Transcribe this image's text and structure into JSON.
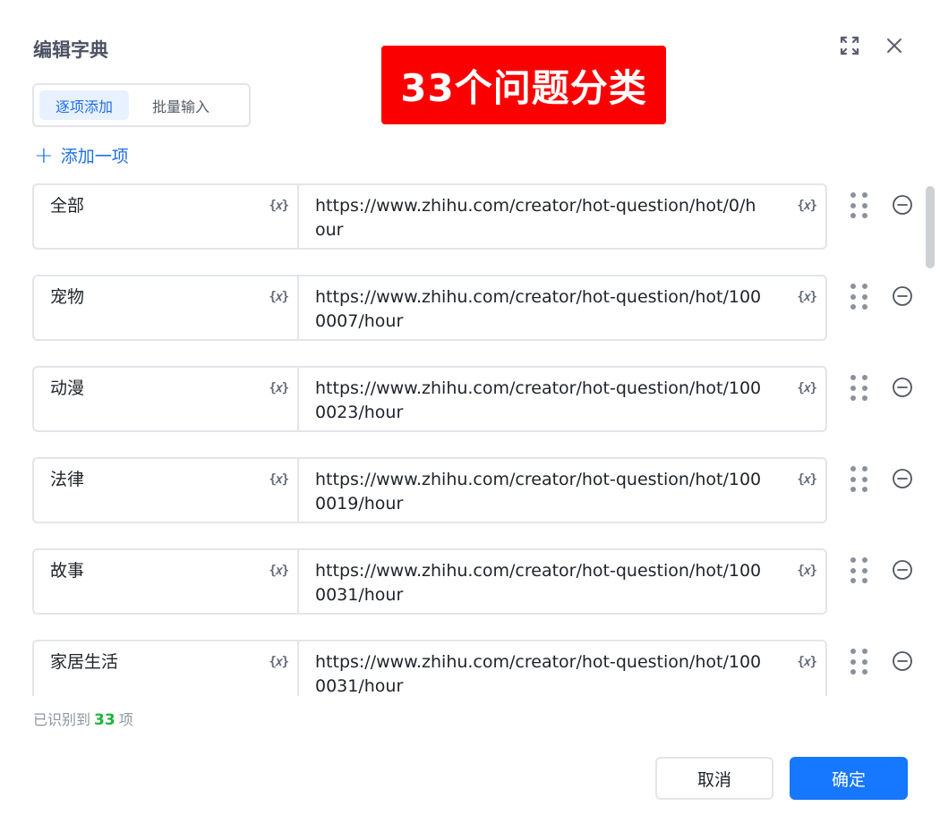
{
  "dialog": {
    "title": "编辑字典",
    "banner": "33个问题分类",
    "tabs": [
      {
        "label": "逐项添加",
        "active": true
      },
      {
        "label": "批量输入",
        "active": false
      }
    ],
    "add_item_label": "添加一项",
    "variable_icon_text": "{𝑥}",
    "rows": [
      {
        "key": "全部",
        "value": "https://www.zhihu.com/creator/hot-question/hot/0/hour"
      },
      {
        "key": "宠物",
        "value": "https://www.zhihu.com/creator/hot-question/hot/1000007/hour"
      },
      {
        "key": "动漫",
        "value": "https://www.zhihu.com/creator/hot-question/hot/1000023/hour"
      },
      {
        "key": "法律",
        "value": "https://www.zhihu.com/creator/hot-question/hot/1000019/hour"
      },
      {
        "key": "故事",
        "value": "https://www.zhihu.com/creator/hot-question/hot/1000031/hour"
      },
      {
        "key": "家居生活",
        "value": "https://www.zhihu.com/creator/hot-question/hot/1000031/hour"
      }
    ],
    "summary_prefix": "已识别到",
    "summary_count": "33",
    "summary_suffix": "项",
    "cancel_label": "取消",
    "confirm_label": "确定",
    "icons": {
      "expand": "expand-icon",
      "close": "close-icon",
      "add": "plus-icon",
      "variable": "variable-icon",
      "drag": "drag-handle-icon",
      "remove": "minus-circle-icon"
    },
    "colors": {
      "primary": "#1677ff",
      "banner_bg": "#fb0000",
      "count_green": "#1eb33d",
      "tab_active_bg": "#e8f1ff"
    }
  }
}
